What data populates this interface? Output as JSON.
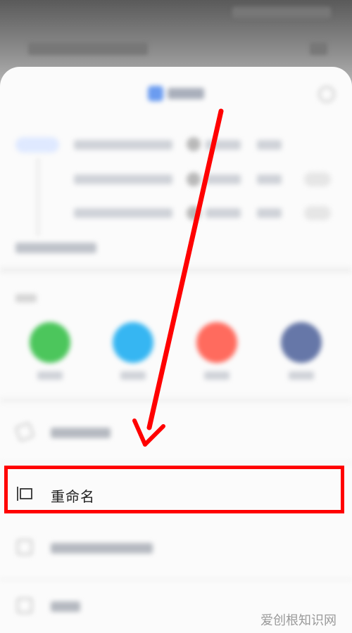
{
  "rename_item": {
    "label": "重命名",
    "icon": "rename-icon"
  },
  "watermark": "爱创根知识网",
  "colors": {
    "highlight": "#ff0000",
    "arrow": "#ff0000",
    "share_green": "#4cc65c",
    "share_blue": "#36b6f2",
    "share_red": "#ff6b5e",
    "share_indigo": "#6677a8"
  }
}
